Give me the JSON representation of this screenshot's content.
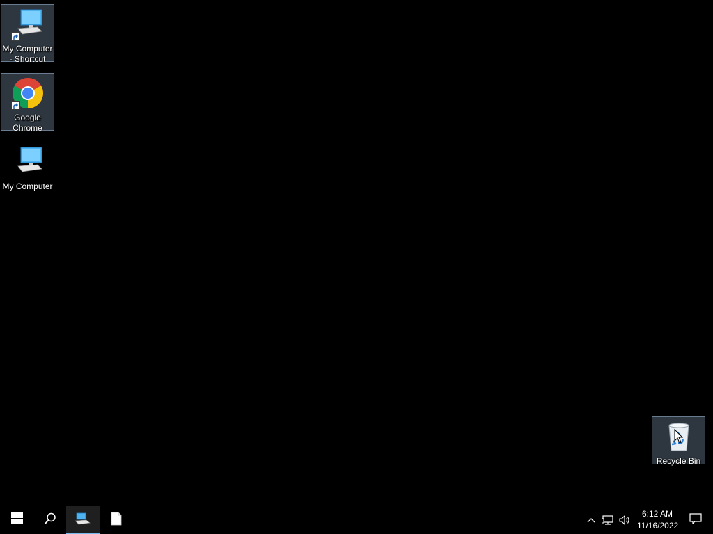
{
  "desktop": {
    "icons": [
      {
        "label": "My Computer - Shortcut",
        "icon": "computer-shortcut-icon",
        "selected": true
      },
      {
        "label": "Google Chrome",
        "icon": "chrome-icon",
        "selected": true
      },
      {
        "label": "My Computer",
        "icon": "computer-icon",
        "selected": false
      },
      {
        "label": "Recycle Bin",
        "icon": "recycle-bin-icon",
        "selected": true
      }
    ]
  },
  "taskbar": {
    "start": "windows-start-icon",
    "search": "search-icon",
    "apps": [
      {
        "icon": "file-explorer-app-icon",
        "active": true
      },
      {
        "icon": "blank-document-icon",
        "active": false
      }
    ],
    "tray": {
      "icons": [
        "chevron-up-icon",
        "network-icon",
        "volume-icon"
      ],
      "time": "6:12 AM",
      "date": "11/16/2022",
      "notifications": "action-center-icon"
    }
  },
  "colors": {
    "background": "#000000",
    "selection": "#99b4d1",
    "taskbar_accent": "#76b9ed"
  }
}
